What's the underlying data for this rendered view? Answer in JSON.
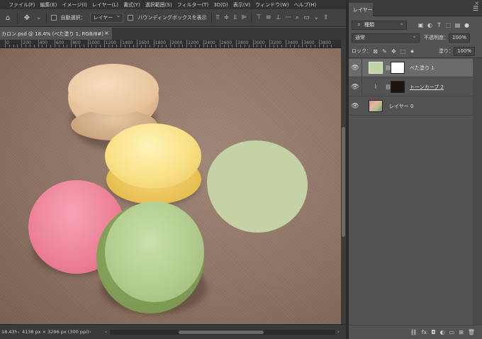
{
  "menubar": {
    "items": [
      "ファイル(F)",
      "編集(E)",
      "イメージ(I)",
      "レイヤー(L)",
      "書式(Y)",
      "選択範囲(S)",
      "フィルター(T)",
      "3D(D)",
      "表示(V)",
      "ウィンドウ(W)",
      "ヘルプ(H)"
    ]
  },
  "options": {
    "auto_select_label": "自動選択：",
    "auto_select_value": "レイヤー",
    "bounding_box_label": "バウンディングボックスを表示"
  },
  "document": {
    "tab_title": "カロン.psd @ 18.4% (べた塗り 1, RGB/8#) *",
    "close_glyph": "×"
  },
  "ruler": {
    "labels": [
      "0",
      "200",
      "400",
      "600",
      "800",
      "1000",
      "1200",
      "1400",
      "1600",
      "1800",
      "2000",
      "2200",
      "2400",
      "2600",
      "2800",
      "3000",
      "3200",
      "3400",
      "3600",
      "3800"
    ]
  },
  "status": {
    "zoom": "18.43%",
    "doc_info": "4138 px × 3296 px (300 ppi)",
    "arrow_glyph": "›",
    "left_arrow": "‹",
    "right_arrow": "›"
  },
  "layers_panel": {
    "tab_label": "レイヤー",
    "filter_value": "種類",
    "blend_mode": "通常",
    "opacity_label": "不透明度：",
    "opacity_value": "100%",
    "lock_label": "ロック：",
    "fill_label": "塗り：",
    "fill_value": "100%",
    "layers": [
      {
        "name": "べた塗り 1",
        "selected": true,
        "kind": "fill",
        "color": "#c2d3a6"
      },
      {
        "name": "トーンカーブ 2",
        "selected": false,
        "kind": "curves"
      },
      {
        "name": "レイヤー 0",
        "selected": false,
        "kind": "image"
      }
    ]
  },
  "colors": {
    "fill_color": "#c4d2a5",
    "canvas_bg": "#8f7565"
  }
}
